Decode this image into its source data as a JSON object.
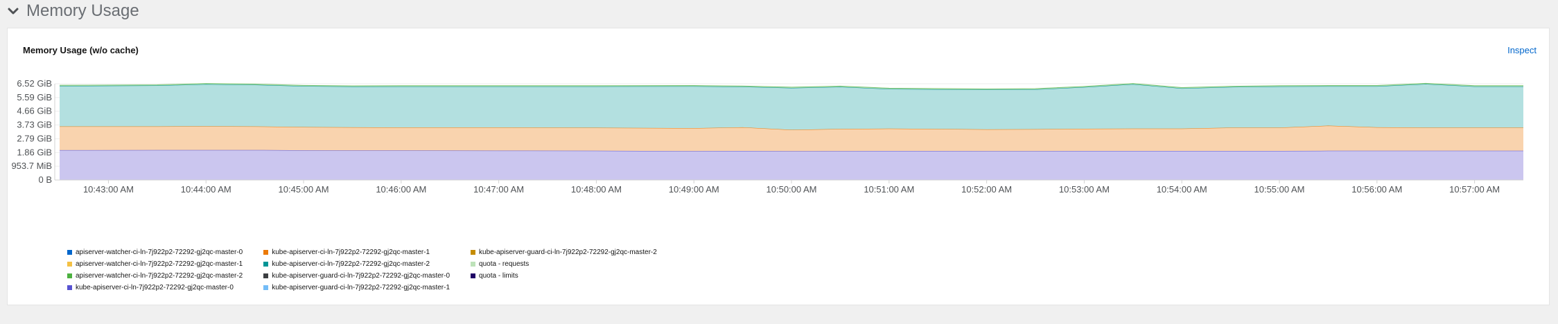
{
  "section": {
    "title": "Memory Usage",
    "collapse_icon": "chevron-down-icon"
  },
  "card": {
    "title": "Memory Usage (w/o cache)",
    "inspect_label": "Inspect"
  },
  "chart_data": {
    "type": "area",
    "stacked": true,
    "title": "Memory Usage (w/o cache)",
    "x_ticks": [
      "10:43:00 AM",
      "10:44:00 AM",
      "10:45:00 AM",
      "10:46:00 AM",
      "10:47:00 AM",
      "10:48:00 AM",
      "10:49:00 AM",
      "10:50:00 AM",
      "10:51:00 AM",
      "10:52:00 AM",
      "10:53:00 AM",
      "10:54:00 AM",
      "10:55:00 AM",
      "10:56:00 AM",
      "10:57:00 AM"
    ],
    "y_ticks": [
      {
        "label": "0 B",
        "gib": 0
      },
      {
        "label": "953.7 MiB",
        "gib": 0.9313
      },
      {
        "label": "1.86 GiB",
        "gib": 1.86
      },
      {
        "label": "2.79 GiB",
        "gib": 2.79
      },
      {
        "label": "3.73 GiB",
        "gib": 3.73
      },
      {
        "label": "4.66 GiB",
        "gib": 4.66
      },
      {
        "label": "5.59 GiB",
        "gib": 5.59
      },
      {
        "label": "6.52 GiB",
        "gib": 6.52
      }
    ],
    "ylim_gib": [
      0,
      6.52
    ],
    "xlim": [
      "10:42:27 AM",
      "10:57:30 AM"
    ],
    "grid": true,
    "legend_position": "bottom",
    "x": [
      "10:42:30 AM",
      "10:43:30 AM",
      "10:44:00 AM",
      "10:44:30 AM",
      "10:45:00 AM",
      "10:45:30 AM",
      "10:46:00 AM",
      "10:47:00 AM",
      "10:48:00 AM",
      "10:49:00 AM",
      "10:49:30 AM",
      "10:50:00 AM",
      "10:50:30 AM",
      "10:51:00 AM",
      "10:52:00 AM",
      "10:52:30 AM",
      "10:53:00 AM",
      "10:53:30 AM",
      "10:54:00 AM",
      "10:54:30 AM",
      "10:55:00 AM",
      "10:55:30 AM",
      "10:56:00 AM",
      "10:56:30 AM",
      "10:57:00 AM",
      "10:57:30 AM"
    ],
    "series": [
      {
        "name": "kube-apiserver-ci-ln-7j922p2-72292-gj2qc-master-0",
        "color": "#cbc6ef",
        "stroke": "#5752d1",
        "values": [
          2.02,
          2.03,
          2.03,
          2.03,
          2.01,
          2.0,
          2.0,
          1.99,
          1.98,
          1.96,
          1.97,
          1.95,
          1.96,
          1.97,
          1.96,
          1.96,
          1.97,
          1.97,
          1.97,
          1.97,
          1.97,
          1.98,
          1.98,
          1.98,
          1.98,
          1.98
        ]
      },
      {
        "name": "kube-apiserver-ci-ln-7j922p2-72292-gj2qc-master-1",
        "color": "#f9d3ae",
        "stroke": "#ec7a08",
        "values": [
          1.61,
          1.6,
          1.61,
          1.6,
          1.58,
          1.57,
          1.56,
          1.57,
          1.56,
          1.55,
          1.6,
          1.45,
          1.5,
          1.51,
          1.47,
          1.48,
          1.5,
          1.51,
          1.51,
          1.58,
          1.58,
          1.7,
          1.59,
          1.57,
          1.57,
          1.57
        ]
      },
      {
        "name": "kube-apiserver-ci-ln-7j922p2-72292-gj2qc-master-2",
        "color": "#b3e0e0",
        "stroke": "#009596",
        "values": [
          2.74,
          2.77,
          2.85,
          2.82,
          2.77,
          2.76,
          2.78,
          2.78,
          2.8,
          2.84,
          2.75,
          2.84,
          2.85,
          2.69,
          2.69,
          2.7,
          2.82,
          3.01,
          2.73,
          2.75,
          2.79,
          2.67,
          2.78,
          2.95,
          2.79,
          2.79
        ]
      },
      {
        "name": "quota - requests",
        "color": "#bde2b9",
        "stroke": "#7cc674",
        "values": [
          0.05,
          0.05,
          0.05,
          0.05,
          0.05,
          0.05,
          0.05,
          0.05,
          0.05,
          0.05,
          0.05,
          0.05,
          0.05,
          0.05,
          0.05,
          0.05,
          0.05,
          0.05,
          0.05,
          0.05,
          0.05,
          0.05,
          0.05,
          0.05,
          0.05,
          0.05
        ]
      }
    ],
    "legend": [
      {
        "name": "apiserver-watcher-ci-ln-7j922p2-72292-gj2qc-master-0",
        "color": "#0066cc"
      },
      {
        "name": "apiserver-watcher-ci-ln-7j922p2-72292-gj2qc-master-1",
        "color": "#f4c145"
      },
      {
        "name": "apiserver-watcher-ci-ln-7j922p2-72292-gj2qc-master-2",
        "color": "#4cb140"
      },
      {
        "name": "kube-apiserver-ci-ln-7j922p2-72292-gj2qc-master-0",
        "color": "#5752d1"
      },
      {
        "name": "kube-apiserver-ci-ln-7j922p2-72292-gj2qc-master-1",
        "color": "#ec7a08"
      },
      {
        "name": "kube-apiserver-ci-ln-7j922p2-72292-gj2qc-master-2",
        "color": "#009596"
      },
      {
        "name": "kube-apiserver-guard-ci-ln-7j922p2-72292-gj2qc-master-0",
        "color": "#3c3f42"
      },
      {
        "name": "kube-apiserver-guard-ci-ln-7j922p2-72292-gj2qc-master-1",
        "color": "#73bcf7"
      },
      {
        "name": "kube-apiserver-guard-ci-ln-7j922p2-72292-gj2qc-master-2",
        "color": "#c58c00"
      },
      {
        "name": "quota - requests",
        "color": "#bde2b9"
      },
      {
        "name": "quota - limits",
        "color": "#1f0066"
      }
    ]
  }
}
